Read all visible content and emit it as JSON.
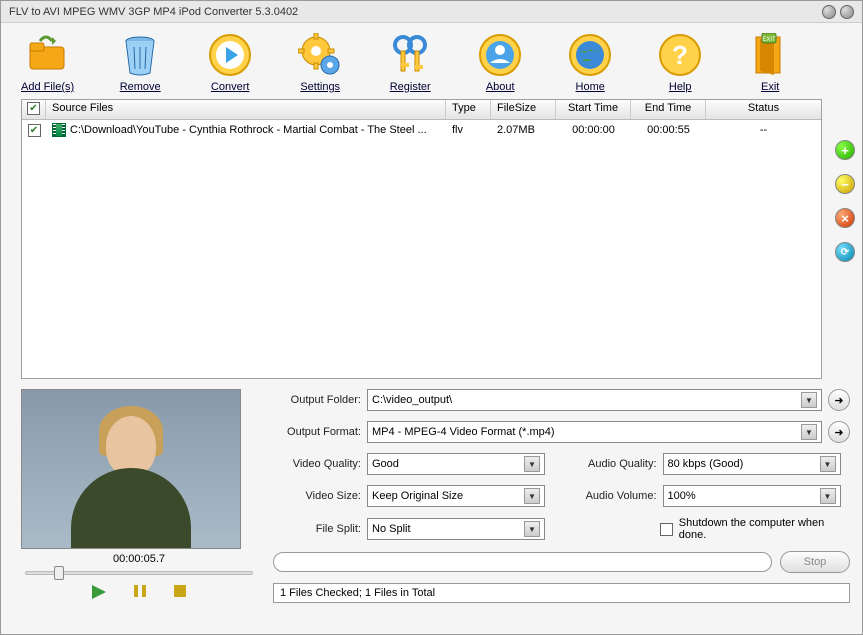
{
  "title": "FLV to AVI MPEG WMV 3GP MP4 iPod Converter 5.3.0402",
  "toolbar": [
    {
      "label": "Add File(s)",
      "icon": "folder-add"
    },
    {
      "label": "Remove",
      "icon": "trash"
    },
    {
      "label": "Convert",
      "icon": "play-circle"
    },
    {
      "label": "Settings",
      "icon": "gear"
    },
    {
      "label": "Register",
      "icon": "key"
    },
    {
      "label": "About",
      "icon": "user-circle"
    },
    {
      "label": "Home",
      "icon": "globe"
    },
    {
      "label": "Help",
      "icon": "help-circle"
    },
    {
      "label": "Exit",
      "icon": "exit-door"
    }
  ],
  "columns": {
    "chk": "",
    "src": "Source Files",
    "type": "Type",
    "size": "FileSize",
    "start": "Start Time",
    "end": "End Time",
    "status": "Status"
  },
  "rows": [
    {
      "checked": true,
      "src": "C:\\Download\\YouTube - Cynthia Rothrock - Martial Combat - The Steel ...",
      "type": "flv",
      "size": "2.07MB",
      "start": "00:00:00",
      "end": "00:00:55",
      "status": "--"
    }
  ],
  "preview": {
    "time": "00:00:05.7"
  },
  "settings": {
    "output_folder_label": "Output Folder:",
    "output_folder": "C:\\video_output\\",
    "output_format_label": "Output Format:",
    "output_format": "MP4 - MPEG-4 Video Format (*.mp4)",
    "video_quality_label": "Video Quality:",
    "video_quality": "Good",
    "audio_quality_label": "Audio Quality:",
    "audio_quality": "80  kbps (Good)",
    "video_size_label": "Video Size:",
    "video_size": "Keep Original Size",
    "audio_volume_label": "Audio Volume:",
    "audio_volume": "100%",
    "file_split_label": "File Split:",
    "file_split": "No Split",
    "shutdown_label": "Shutdown the computer when done.",
    "shutdown_checked": false,
    "stop_label": "Stop"
  },
  "statusbar": "1 Files Checked; 1 Files in Total"
}
